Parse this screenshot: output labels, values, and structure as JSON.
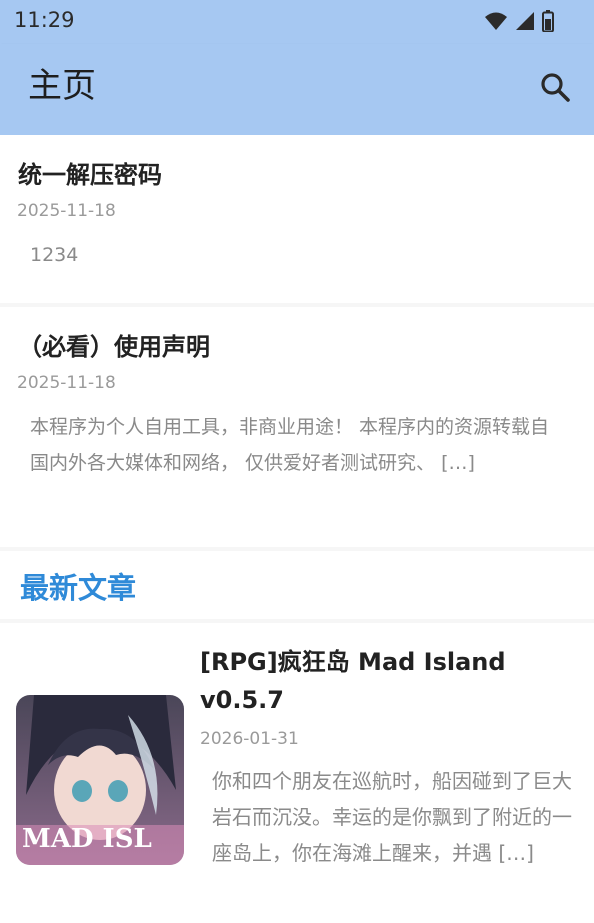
{
  "status_bar": {
    "time": "11:29",
    "icons": [
      "wifi-icon",
      "cell-signal-icon",
      "battery-icon"
    ]
  },
  "app_bar": {
    "title": "主页",
    "search_icon": "search-icon"
  },
  "posts": [
    {
      "title": "统一解压密码",
      "date": "2025-11-18",
      "excerpt": "1234"
    },
    {
      "title": "（必看）使用声明",
      "date": "2025-11-18",
      "excerpt": "本程序为个人自用工具，非商业用途！ 本程序内的资源转载自国内外各大媒体和网络， 仅供爱好者测试研究、 […]"
    }
  ],
  "latest_section": {
    "title": "最新文章"
  },
  "articles": [
    {
      "title": "[RPG]疯狂岛  Mad Island v0.5.7",
      "date": "2026-01-31",
      "excerpt": "你和四个朋友在巡航时，船因碰到了巨大岩石而沉没。幸运的是你飘到了附近的一座岛上，你在海滩上醒来，并遇 […]",
      "thumbnail_text": "MAD ISL"
    }
  ],
  "colors": {
    "app_bar": "#a6c8f2",
    "accent": "#2f8ad8",
    "title_text": "#222222",
    "muted_text": "#8a8a8a"
  }
}
